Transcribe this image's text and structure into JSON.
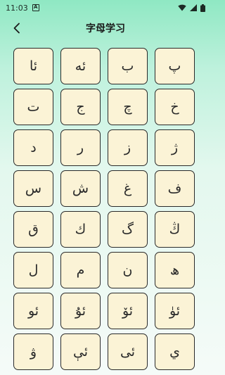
{
  "status": {
    "time": "11:03",
    "indicator": "A"
  },
  "header": {
    "title": "字母学习"
  },
  "letters": [
    "ئا",
    "ئە",
    "ب",
    "پ",
    "ت",
    "ج",
    "چ",
    "خ",
    "د",
    "ر",
    "ز",
    "ژ",
    "س",
    "ش",
    "غ",
    "ف",
    "ق",
    "ك",
    "گ",
    "ڭ",
    "ل",
    "م",
    "ن",
    "ھ",
    "ئو",
    "ئۇ",
    "ئۆ",
    "ئۈ",
    "ۋ",
    "ئې",
    "ئى",
    "ي"
  ],
  "colors": {
    "tile_bg": "#fbf3d6",
    "tile_border": "#2a2a2a",
    "header_gradient_top": "#8fe8c3"
  }
}
